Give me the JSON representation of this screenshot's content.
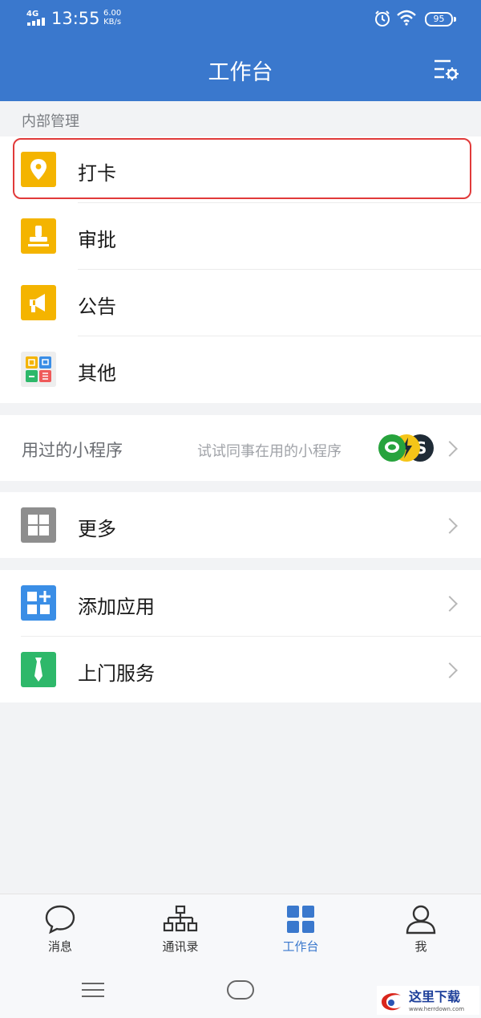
{
  "status_bar": {
    "network": "4G",
    "time": "13:55",
    "speed_value": "6.00",
    "speed_unit": "KB/s",
    "battery": "95"
  },
  "header": {
    "title": "工作台"
  },
  "internal_section": {
    "label": "内部管理",
    "items": [
      {
        "label": "打卡",
        "icon": "location-pin-icon",
        "color": "#f4b400"
      },
      {
        "label": "审批",
        "icon": "stamp-icon",
        "color": "#f4b400"
      },
      {
        "label": "公告",
        "icon": "megaphone-icon",
        "color": "#f4b400"
      },
      {
        "label": "其他",
        "icon": "app-grid-icon",
        "color": "#eeeeee"
      }
    ]
  },
  "mini_programs": {
    "label": "用过的小程序",
    "hint": "试试同事在用的小程序"
  },
  "more": {
    "label": "更多",
    "icon": "grid-icon",
    "color": "#8e8e8e"
  },
  "apps": [
    {
      "label": "添加应用",
      "icon": "add-app-icon",
      "color": "#3a8ee6"
    },
    {
      "label": "上门服务",
      "icon": "tie-icon",
      "color": "#2eb86a"
    }
  ],
  "tabbar": {
    "tabs": [
      {
        "label": "消息",
        "icon": "chat-bubble-icon"
      },
      {
        "label": "通讯录",
        "icon": "org-chart-icon"
      },
      {
        "label": "工作台",
        "icon": "workbench-grid-icon",
        "active": true
      },
      {
        "label": "我",
        "icon": "person-icon"
      }
    ],
    "active_color": "#3a78cd"
  },
  "watermark": {
    "text": "这里下载",
    "url": "www.herrdown.com"
  }
}
